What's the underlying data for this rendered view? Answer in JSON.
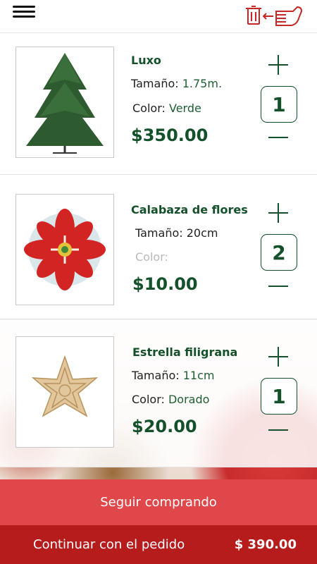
{
  "colors": {
    "accent_green": "#14502a",
    "brand_red": "#b71c1c",
    "button_red": "#e0474a"
  },
  "header": {
    "menu_icon": "hamburger-menu-icon",
    "clear_cart_icon": "trash-swipe-icon"
  },
  "items": [
    {
      "name": "Luxo",
      "size_label": "Tamaño:",
      "size_value": "1.75m.",
      "color_label": "Color:",
      "color_value": "Verde",
      "price": "$350.00",
      "quantity": "1",
      "image_icon": "christmas-tree-image"
    },
    {
      "name": "Calabaza de flores",
      "size_label": "Tamaño:",
      "size_value": "20cm",
      "color_label": "Color:",
      "color_value": "",
      "price": "$10.00",
      "quantity": "2",
      "image_icon": "paper-flower-ornament-image"
    },
    {
      "name": "Estrella filigrana",
      "size_label": "Tamaño:",
      "size_value": "11cm",
      "color_label": "Color:",
      "color_value": "Dorado",
      "price": "$20.00",
      "quantity": "1",
      "image_icon": "filigree-star-image"
    }
  ],
  "footer": {
    "keep_shopping": "Seguir comprando",
    "continue_label": "Continuar con el pedido",
    "total": "$ 390.00"
  }
}
